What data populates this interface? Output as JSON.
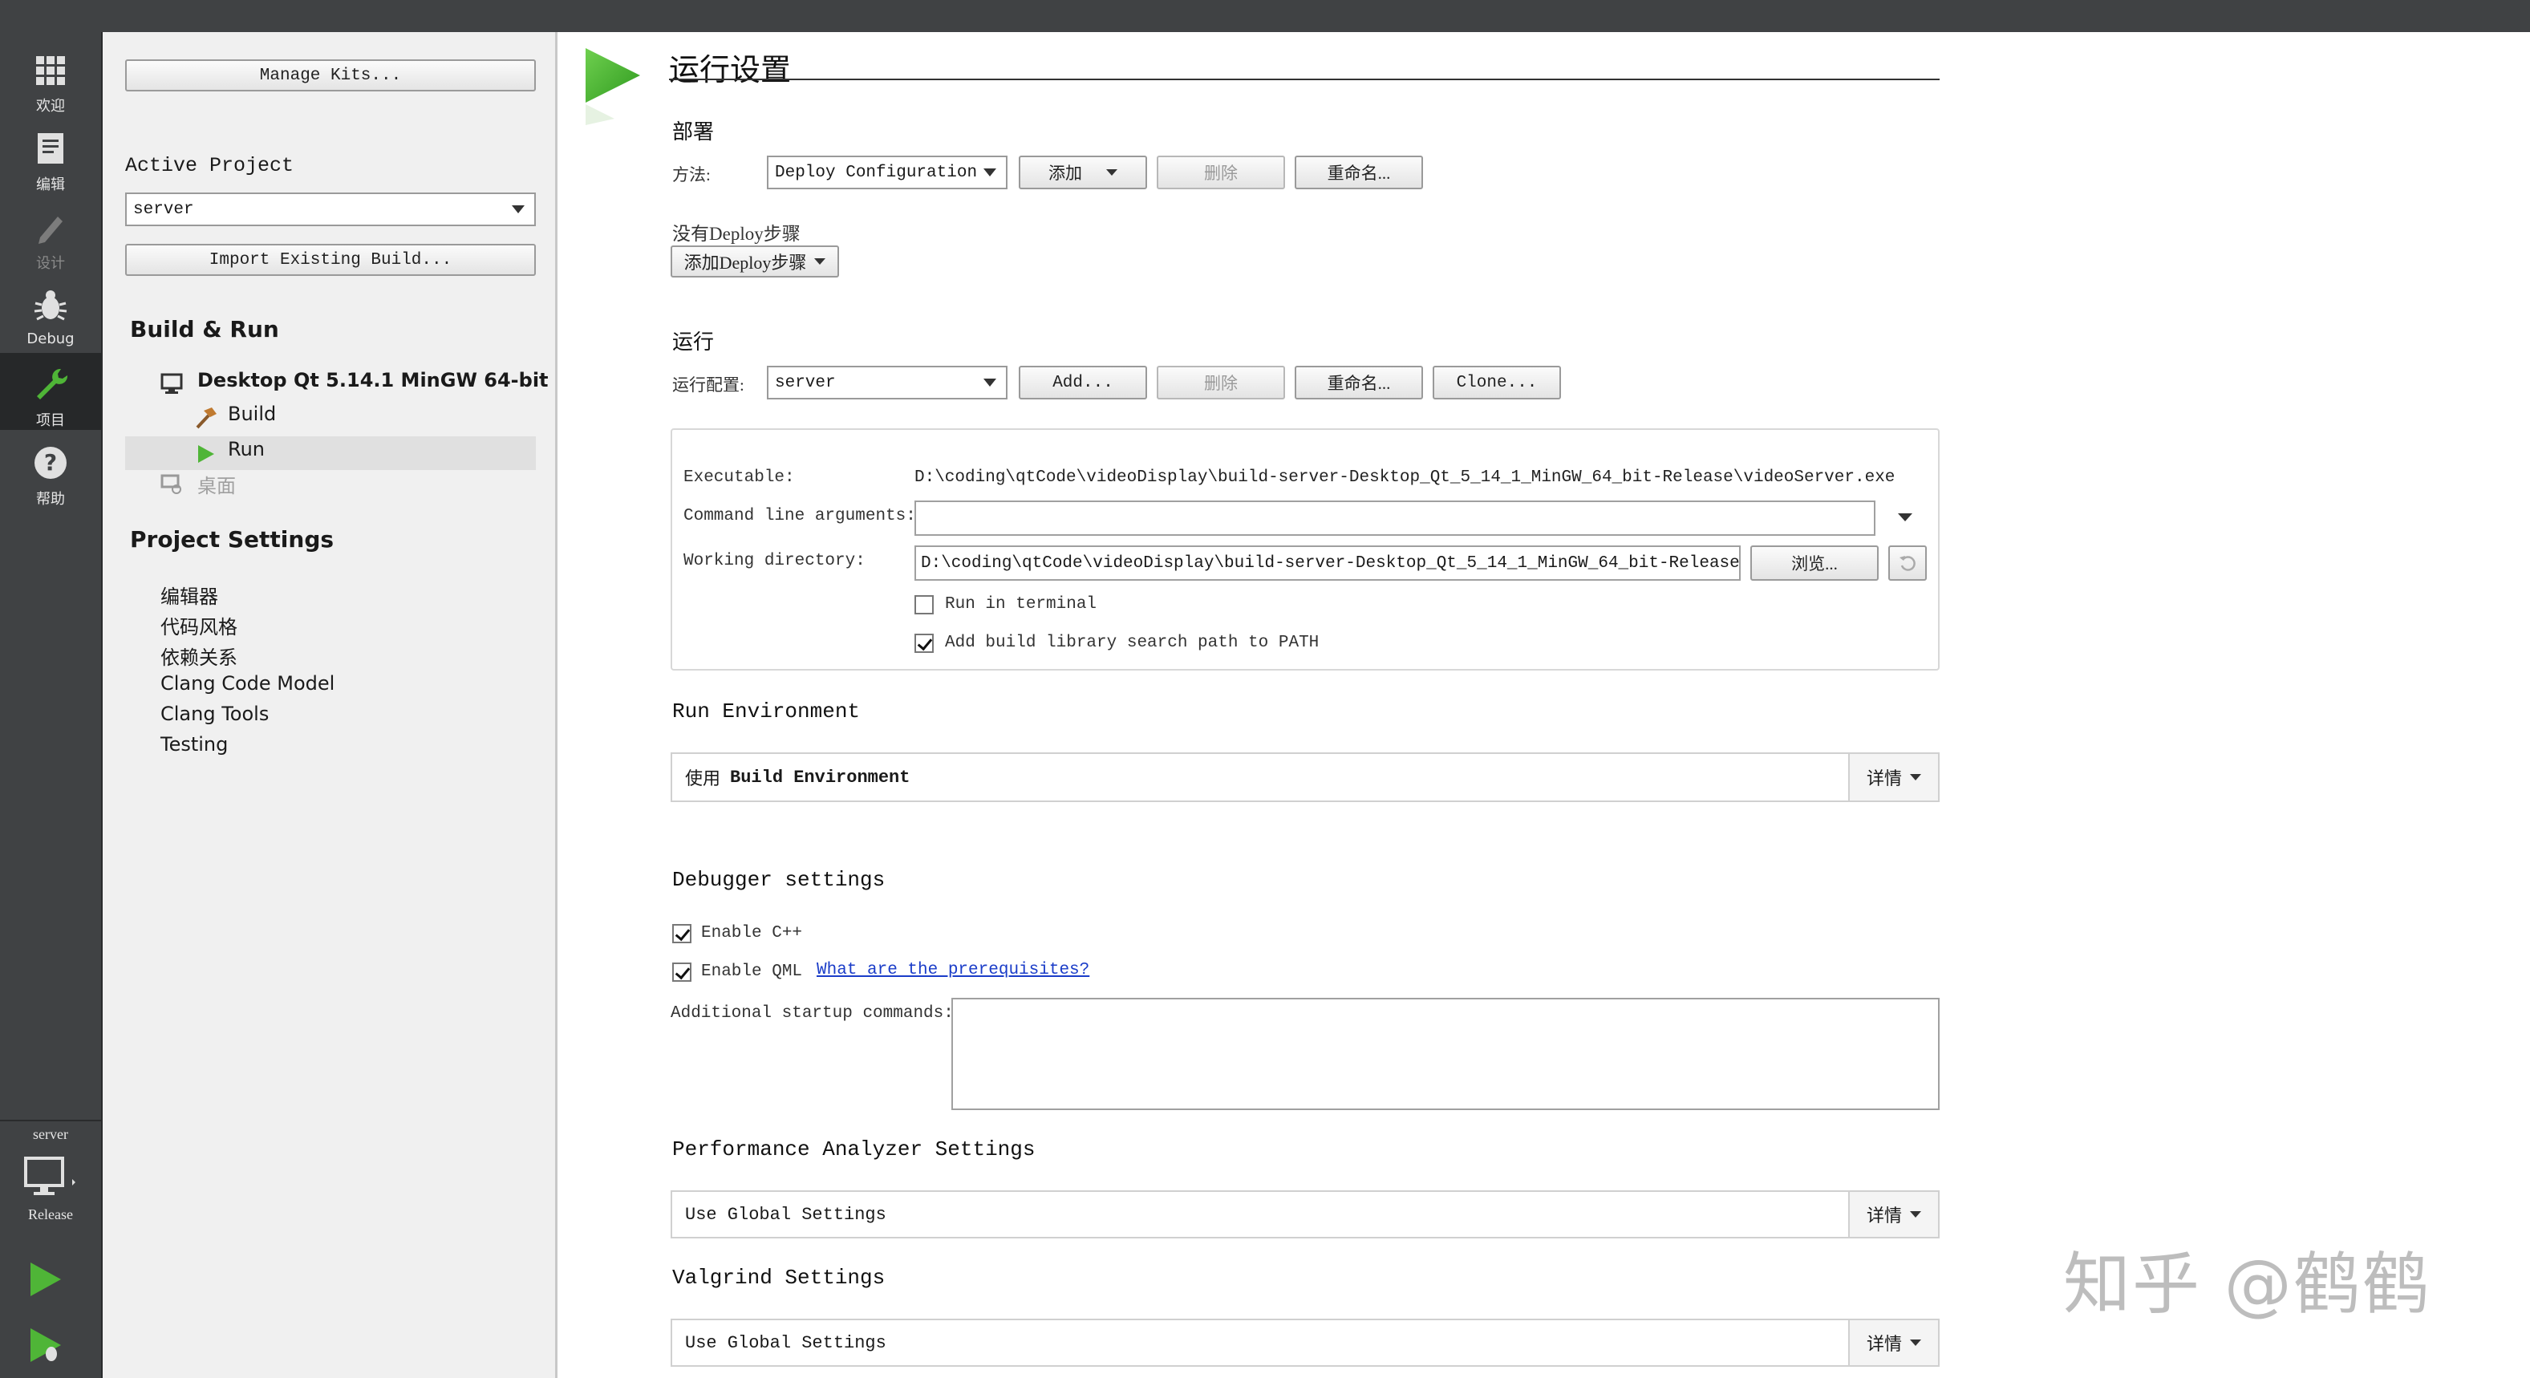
{
  "modes": [
    {
      "label": "欢迎",
      "icon": "grid-icon"
    },
    {
      "label": "编辑",
      "icon": "document-icon"
    },
    {
      "label": "设计",
      "icon": "pencil-icon"
    },
    {
      "label": "Debug",
      "icon": "bug-icon"
    },
    {
      "label": "项目",
      "icon": "wrench-icon"
    },
    {
      "label": "帮助",
      "icon": "help-icon"
    }
  ],
  "target": {
    "project": "server",
    "config": "Release"
  },
  "sidebar": {
    "manage_kits": "Manage Kits...",
    "active_project_label": "Active Project",
    "active_project_value": "server",
    "import_build": "Import Existing Build...",
    "build_run_heading": "Build & Run",
    "kit_name": "Desktop Qt 5.14.1 MinGW 64-bit",
    "build_label": "Build",
    "run_label": "Run",
    "desktop_label": "桌面",
    "project_settings_heading": "Project Settings",
    "settings_items": [
      "编辑器",
      "代码风格",
      "依赖关系",
      "Clang Code Model",
      "Clang Tools",
      "Testing"
    ]
  },
  "main": {
    "title": "运行设置",
    "deploy": {
      "heading": "部署",
      "method_label": "方法:",
      "method_value": "Deploy Configuration",
      "add": "添加",
      "remove": "删除",
      "rename": "重命名...",
      "no_steps": "没有Deploy步骤",
      "add_step": "添加Deploy步骤"
    },
    "run": {
      "heading": "运行",
      "config_label": "运行配置:",
      "config_value": "server",
      "add": "Add...",
      "remove": "删除",
      "rename": "重命名...",
      "clone": "Clone...",
      "executable_label": "Executable:",
      "executable_value": "D:\\coding\\qtCode\\videoDisplay\\build-server-Desktop_Qt_5_14_1_MinGW_64_bit-Release\\videoServer.exe",
      "args_label": "Command line arguments:",
      "args_value": "",
      "workdir_label": "Working directory:",
      "workdir_value": "D:\\coding\\qtCode\\videoDisplay\\build-server-Desktop_Qt_5_14_1_MinGW_64_bit-Release",
      "browse": "浏览...",
      "run_in_terminal": "Run in terminal",
      "run_in_terminal_checked": false,
      "add_lib_path": "Add build library search path to PATH",
      "add_lib_path_checked": true
    },
    "run_env": {
      "heading": "Run Environment",
      "prefix": "使用",
      "value": "Build Environment",
      "details": "详情"
    },
    "debugger": {
      "heading": "Debugger settings",
      "enable_cpp": "Enable C++",
      "enable_qml": "Enable QML",
      "prereq_link": "What are the prerequisites?",
      "startup_label": "Additional startup commands:"
    },
    "perf": {
      "heading": "Performance Analyzer Settings",
      "value": "Use Global Settings",
      "details": "详情"
    },
    "valgrind": {
      "heading": "Valgrind Settings",
      "value": "Use Global Settings",
      "details": "详情"
    }
  },
  "watermark": "知乎 @鹤鹤"
}
